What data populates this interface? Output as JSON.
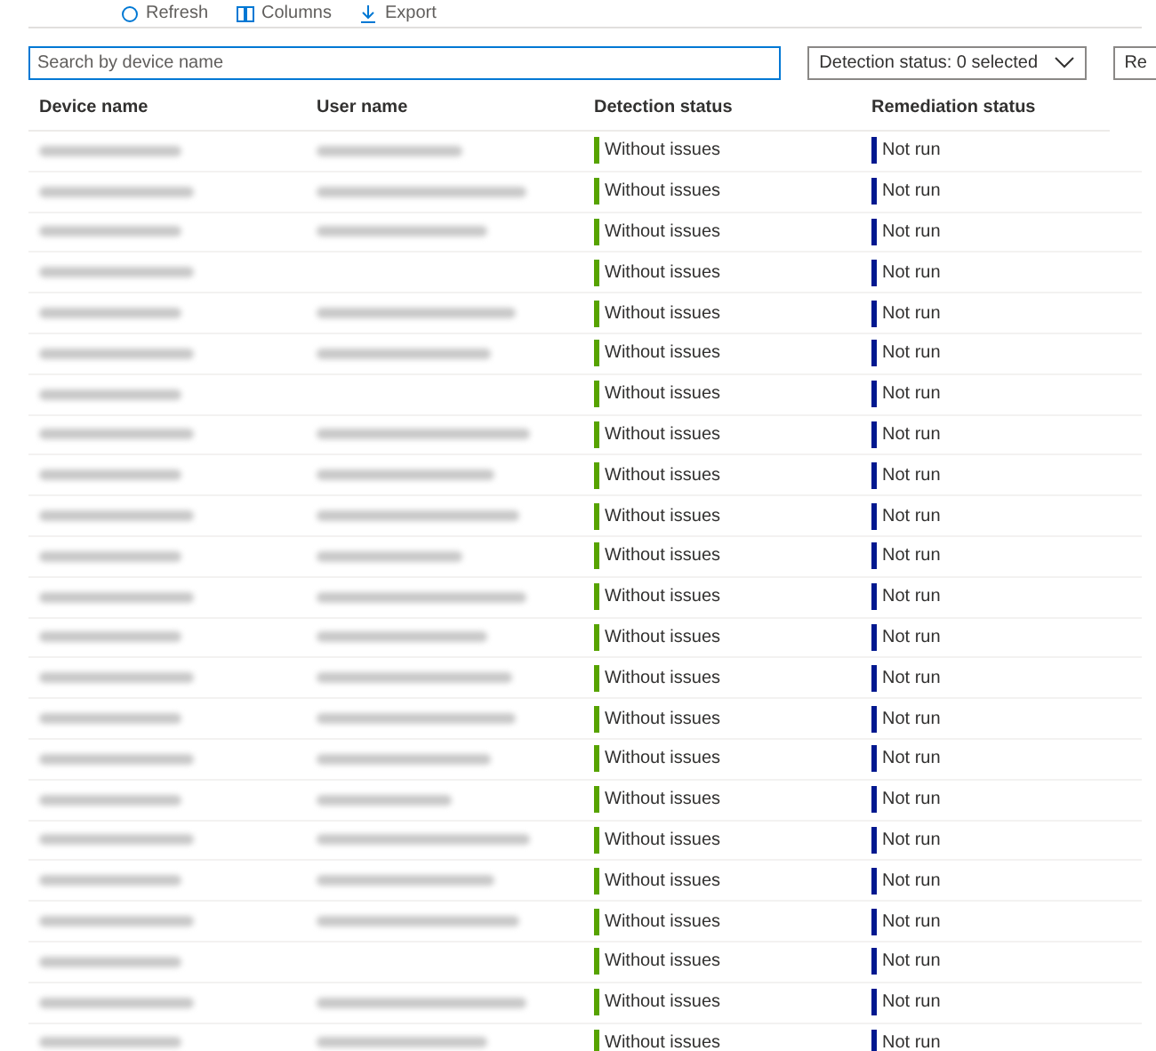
{
  "toolbar": [
    {
      "label": "Refresh"
    },
    {
      "label": "Columns"
    },
    {
      "label": "Export"
    }
  ],
  "search": {
    "placeholder": "Search by device name"
  },
  "filters": [
    {
      "label": "Detection status: 0 selected",
      "dropdown": true
    },
    {
      "label": "Re",
      "dropdown": false
    }
  ],
  "table": {
    "columns": [
      "Device name",
      "User name",
      "Detection status",
      "Remediation status"
    ],
    "rows": [
      {
        "device_blurred": true,
        "user_blurred": true,
        "detection": {
          "label": "Without issues",
          "color": "#57a300"
        },
        "remediation": {
          "label": "Not run",
          "color": "#00188f"
        }
      },
      {
        "device_blurred": true,
        "user_blurred": true,
        "detection": {
          "label": "Without issues",
          "color": "#57a300"
        },
        "remediation": {
          "label": "Not run",
          "color": "#00188f"
        }
      },
      {
        "device_blurred": true,
        "user_blurred": true,
        "detection": {
          "label": "Without issues",
          "color": "#57a300"
        },
        "remediation": {
          "label": "Not run",
          "color": "#00188f"
        }
      },
      {
        "device_blurred": true,
        "user_blurred": false,
        "detection": {
          "label": "Without issues",
          "color": "#57a300"
        },
        "remediation": {
          "label": "Not run",
          "color": "#00188f"
        }
      },
      {
        "device_blurred": true,
        "user_blurred": true,
        "detection": {
          "label": "Without issues",
          "color": "#57a300"
        },
        "remediation": {
          "label": "Not run",
          "color": "#00188f"
        }
      },
      {
        "device_blurred": true,
        "user_blurred": true,
        "detection": {
          "label": "Without issues",
          "color": "#57a300"
        },
        "remediation": {
          "label": "Not run",
          "color": "#00188f"
        }
      },
      {
        "device_blurred": true,
        "user_blurred": false,
        "detection": {
          "label": "Without issues",
          "color": "#57a300"
        },
        "remediation": {
          "label": "Not run",
          "color": "#00188f"
        }
      },
      {
        "device_blurred": true,
        "user_blurred": true,
        "detection": {
          "label": "Without issues",
          "color": "#57a300"
        },
        "remediation": {
          "label": "Not run",
          "color": "#00188f"
        }
      },
      {
        "device_blurred": true,
        "user_blurred": true,
        "detection": {
          "label": "Without issues",
          "color": "#57a300"
        },
        "remediation": {
          "label": "Not run",
          "color": "#00188f"
        }
      },
      {
        "device_blurred": true,
        "user_blurred": true,
        "detection": {
          "label": "Without issues",
          "color": "#57a300"
        },
        "remediation": {
          "label": "Not run",
          "color": "#00188f"
        }
      },
      {
        "device_blurred": true,
        "user_blurred": true,
        "detection": {
          "label": "Without issues",
          "color": "#57a300"
        },
        "remediation": {
          "label": "Not run",
          "color": "#00188f"
        }
      },
      {
        "device_blurred": true,
        "user_blurred": true,
        "detection": {
          "label": "Without issues",
          "color": "#57a300"
        },
        "remediation": {
          "label": "Not run",
          "color": "#00188f"
        }
      },
      {
        "device_blurred": true,
        "user_blurred": true,
        "detection": {
          "label": "Without issues",
          "color": "#57a300"
        },
        "remediation": {
          "label": "Not run",
          "color": "#00188f"
        }
      },
      {
        "device_blurred": true,
        "user_blurred": true,
        "detection": {
          "label": "Without issues",
          "color": "#57a300"
        },
        "remediation": {
          "label": "Not run",
          "color": "#00188f"
        }
      },
      {
        "device_blurred": true,
        "user_blurred": true,
        "detection": {
          "label": "Without issues",
          "color": "#57a300"
        },
        "remediation": {
          "label": "Not run",
          "color": "#00188f"
        }
      },
      {
        "device_blurred": true,
        "user_blurred": true,
        "detection": {
          "label": "Without issues",
          "color": "#57a300"
        },
        "remediation": {
          "label": "Not run",
          "color": "#00188f"
        }
      },
      {
        "device_blurred": true,
        "user_blurred": true,
        "detection": {
          "label": "Without issues",
          "color": "#57a300"
        },
        "remediation": {
          "label": "Not run",
          "color": "#00188f"
        }
      },
      {
        "device_blurred": true,
        "user_blurred": true,
        "detection": {
          "label": "Without issues",
          "color": "#57a300"
        },
        "remediation": {
          "label": "Not run",
          "color": "#00188f"
        }
      },
      {
        "device_blurred": true,
        "user_blurred": true,
        "detection": {
          "label": "Without issues",
          "color": "#57a300"
        },
        "remediation": {
          "label": "Not run",
          "color": "#00188f"
        }
      },
      {
        "device_blurred": true,
        "user_blurred": true,
        "detection": {
          "label": "Without issues",
          "color": "#57a300"
        },
        "remediation": {
          "label": "Not run",
          "color": "#00188f"
        }
      },
      {
        "device_blurred": true,
        "user_blurred": false,
        "detection": {
          "label": "Without issues",
          "color": "#57a300"
        },
        "remediation": {
          "label": "Not run",
          "color": "#00188f"
        }
      },
      {
        "device_blurred": true,
        "user_blurred": true,
        "detection": {
          "label": "Without issues",
          "color": "#57a300"
        },
        "remediation": {
          "label": "Not run",
          "color": "#00188f"
        }
      },
      {
        "device_blurred": true,
        "user_blurred": true,
        "detection": {
          "label": "Without issues",
          "color": "#57a300"
        },
        "remediation": {
          "label": "Not run",
          "color": "#00188f"
        }
      }
    ]
  }
}
